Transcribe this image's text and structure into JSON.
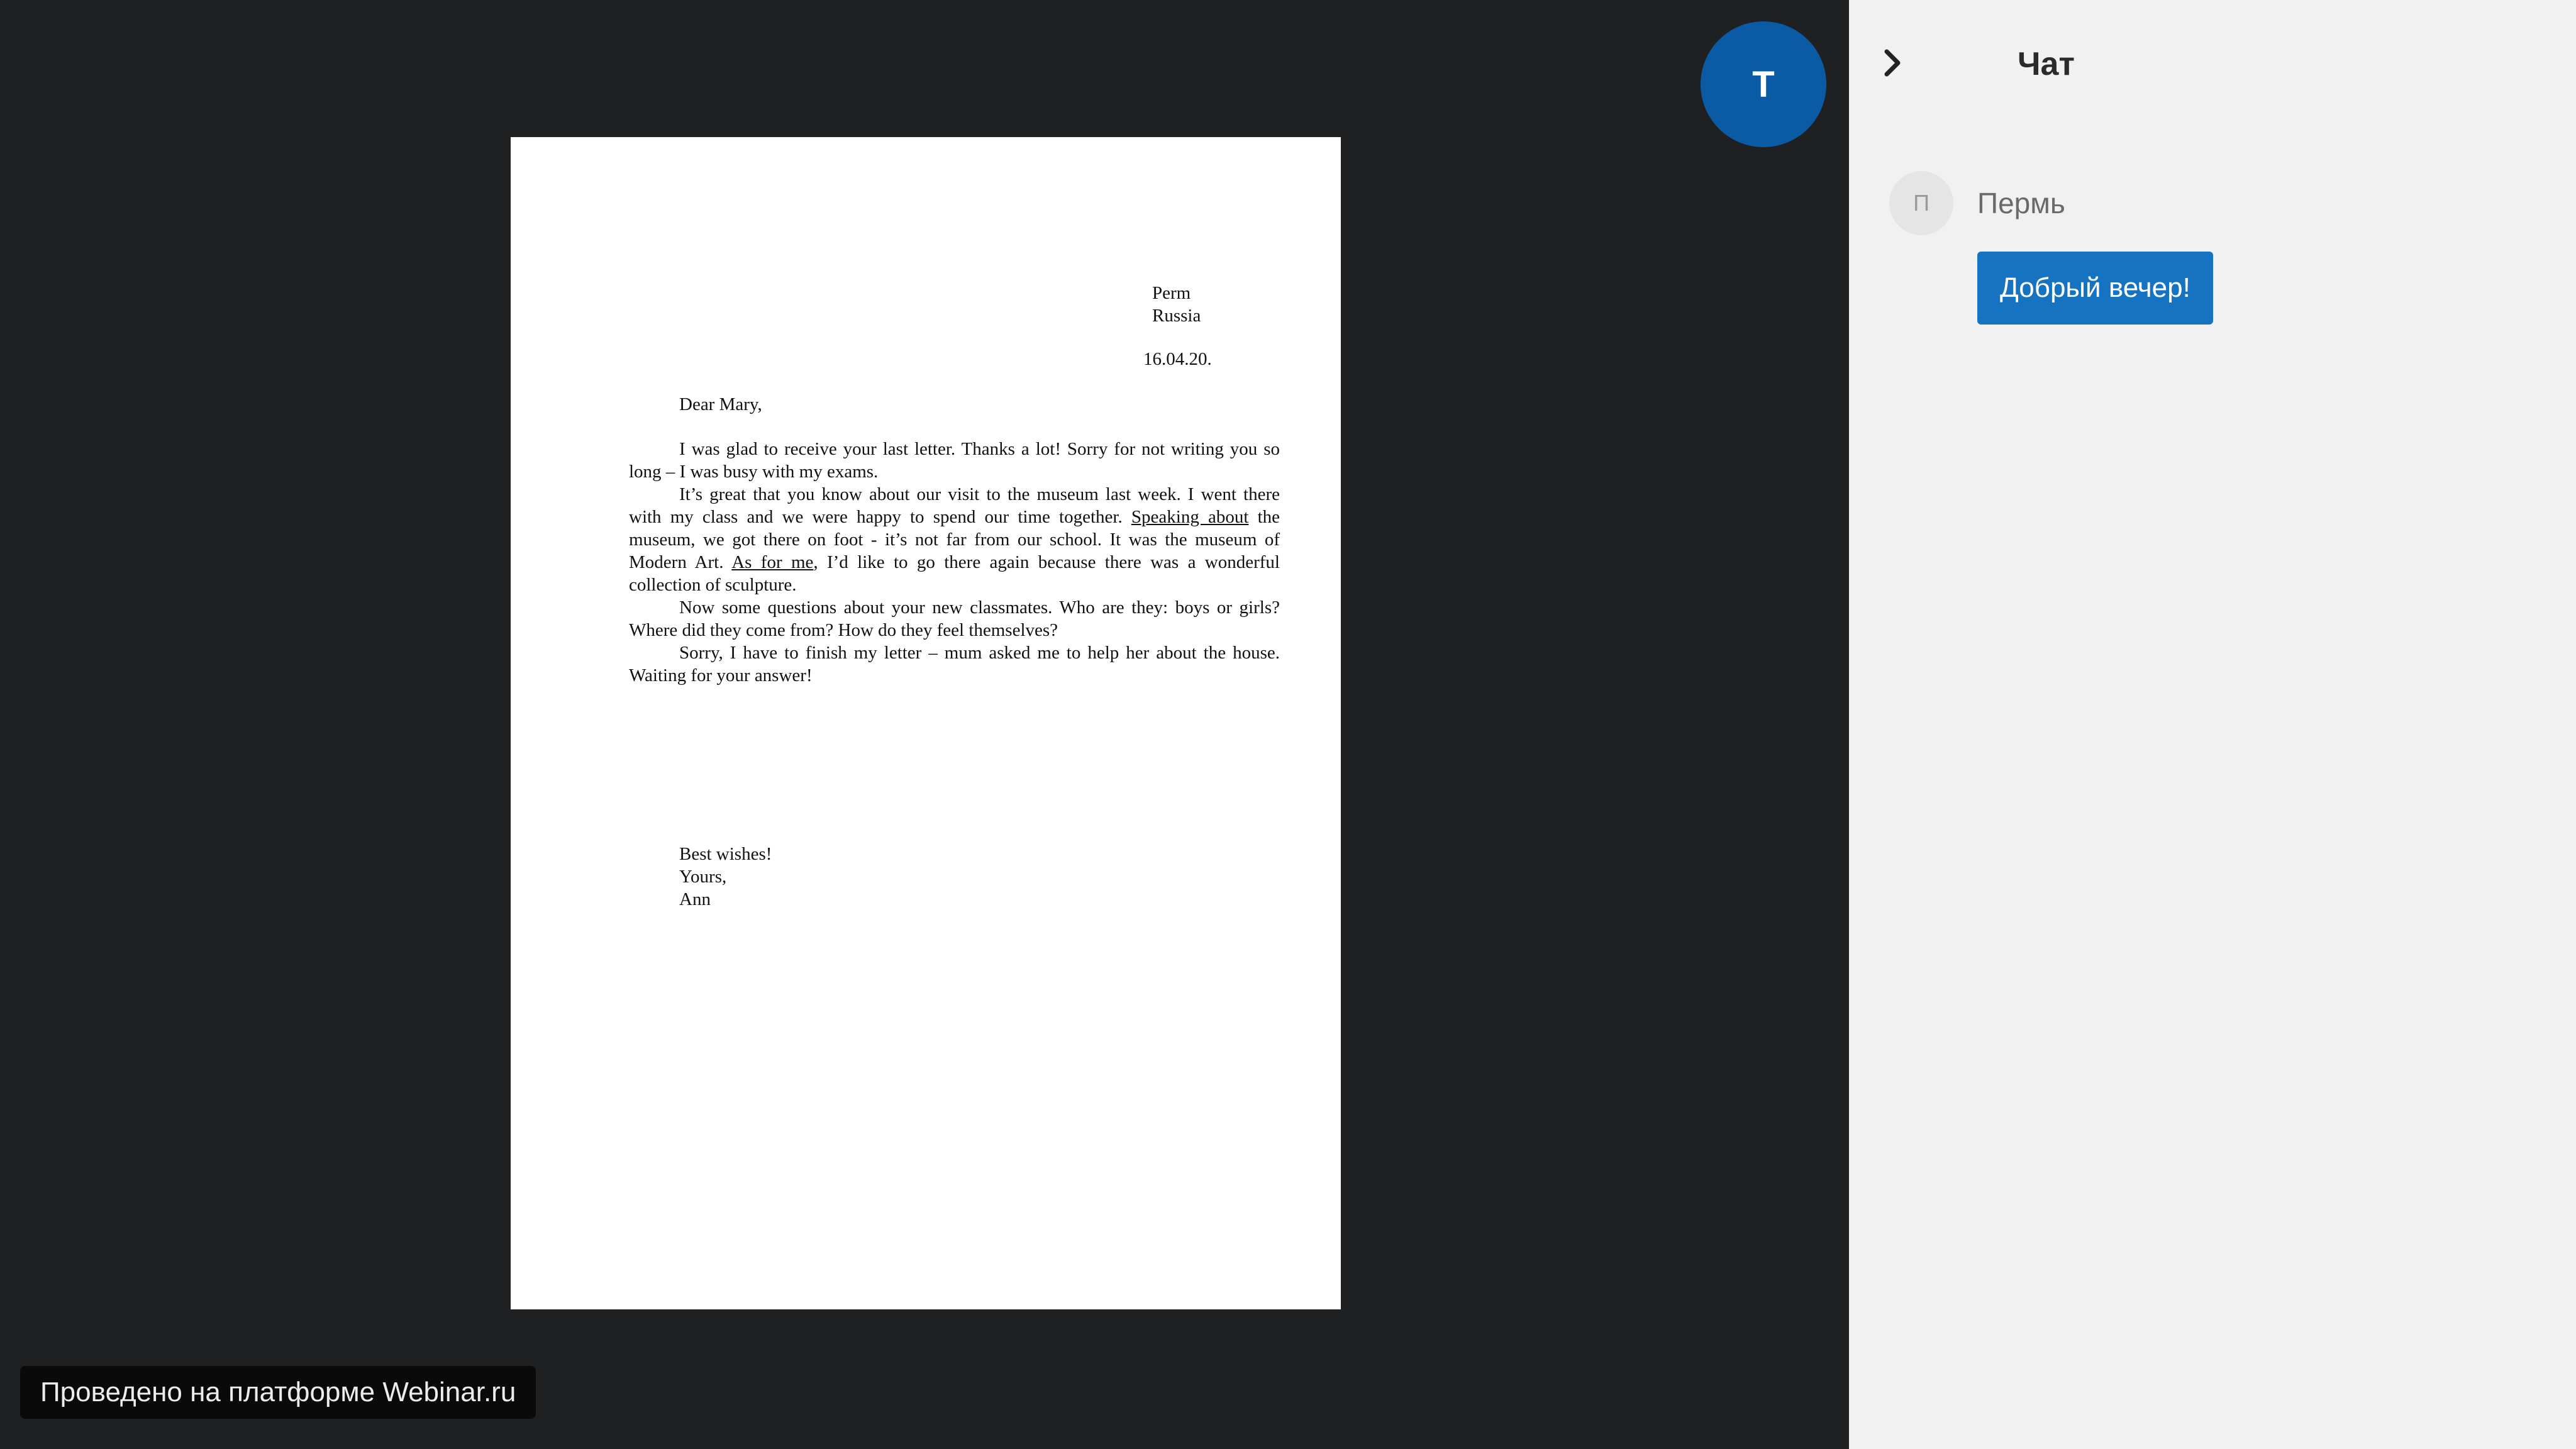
{
  "presenter": {
    "initial": "T",
    "avatar_color": "#0b5ba4"
  },
  "document": {
    "address": [
      "Perm",
      "Russia"
    ],
    "date": "16.04.20.",
    "salutation": "Dear Mary,",
    "paragraphs": [
      "I was glad to receive your last letter. Thanks a lot! Sorry for not writing you so long – I was busy with my exams.",
      "It’s great that you know about our visit to the museum last week. I went there with my class and we were happy to spend our time together. |Speaking about| the museum, we got there on foot - it’s not far from our school. It was the museum of Modern Art. |As for me|, I’d like to go there again because there was a wonderful collection of sculpture.",
      "Now some questions about your new classmates. Who are they: boys or girls? Where did they come from? How do they feel themselves?",
      "Sorry, I have to finish my letter – mum asked me to help her about the house. Waiting for your answer!"
    ],
    "closing": [
      "Best wishes!",
      "Yours,",
      "Ann"
    ]
  },
  "footer": {
    "platform_badge": "Проведено на платформе Webinar.ru"
  },
  "chat": {
    "title": "Чат",
    "collapse_icon": "chevron-right-icon",
    "messages": [
      {
        "avatar_initial": "П",
        "author": "Пермь",
        "text": "Добрый вечер!"
      }
    ]
  },
  "colors": {
    "stage_bg": "#1e2021",
    "chat_bg": "#f1f1f1",
    "bubble": "#1673c2"
  }
}
